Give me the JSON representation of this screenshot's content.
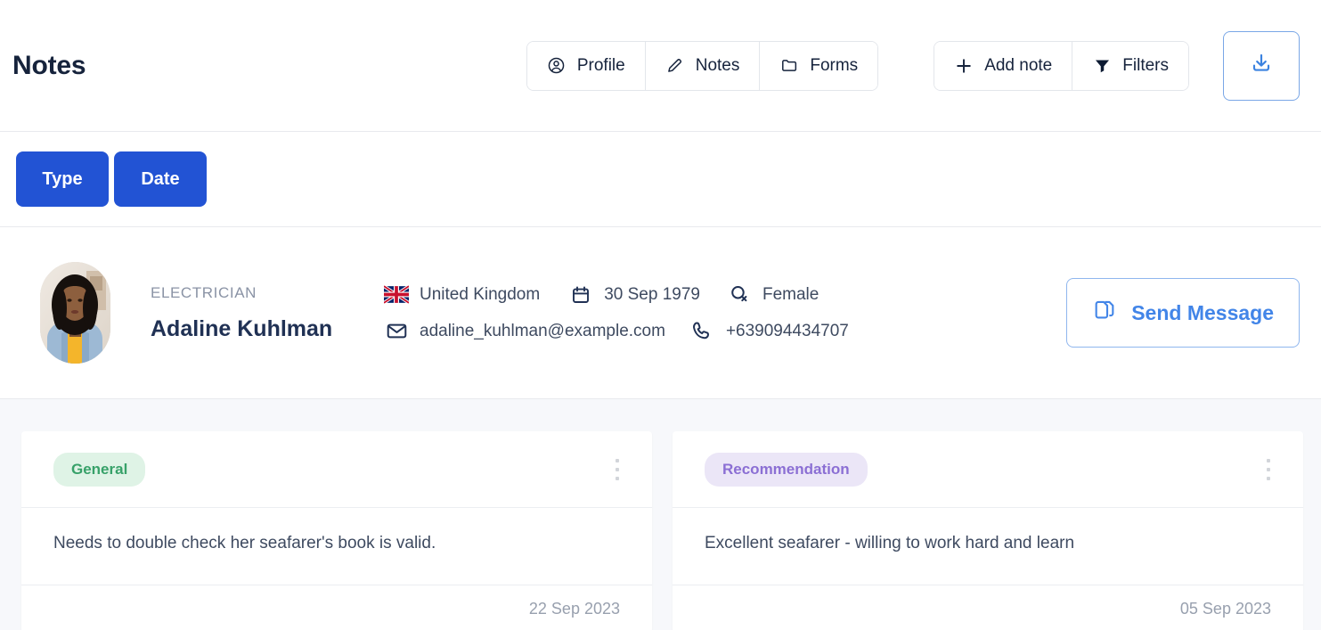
{
  "header": {
    "title": "Notes",
    "nav_tabs": [
      {
        "label": "Profile",
        "icon": "user-circle-icon"
      },
      {
        "label": "Notes",
        "icon": "pencil-icon"
      },
      {
        "label": "Forms",
        "icon": "folder-icon"
      }
    ],
    "actions": [
      {
        "label": "Add note",
        "icon": "plus-icon"
      },
      {
        "label": "Filters",
        "icon": "funnel-icon"
      }
    ],
    "download_button": {
      "icon": "download-icon",
      "color": "#3b82e0"
    }
  },
  "filters": {
    "chips": [
      {
        "label": "Type"
      },
      {
        "label": "Date"
      }
    ],
    "chip_color": "#2253d4"
  },
  "profile": {
    "avatar_alt": "Adaline Kuhlman portrait",
    "role": "ELECTRICIAN",
    "name": "Adaline Kuhlman",
    "details": {
      "country": "United Kingdom",
      "country_flag": "united-kingdom-flag",
      "birth_date": "30 Sep 1979",
      "gender": "Female",
      "email": "adaline_kuhlman@example.com",
      "phone": "+639094434707"
    },
    "send_message_label": "Send Message",
    "send_message_color": "#4285e8"
  },
  "notes": [
    {
      "category": "General",
      "category_color": "#37a169",
      "category_bg": "#dff3e6",
      "text": "Needs to double check her seafarer's book is valid.",
      "date": "22 Sep 2023"
    },
    {
      "category": "Recommendation",
      "category_color": "#8b6fd4",
      "category_bg": "#ebe6f7",
      "text": "Excellent seafarer - willing to work hard and learn",
      "date": "05 Sep 2023"
    }
  ]
}
